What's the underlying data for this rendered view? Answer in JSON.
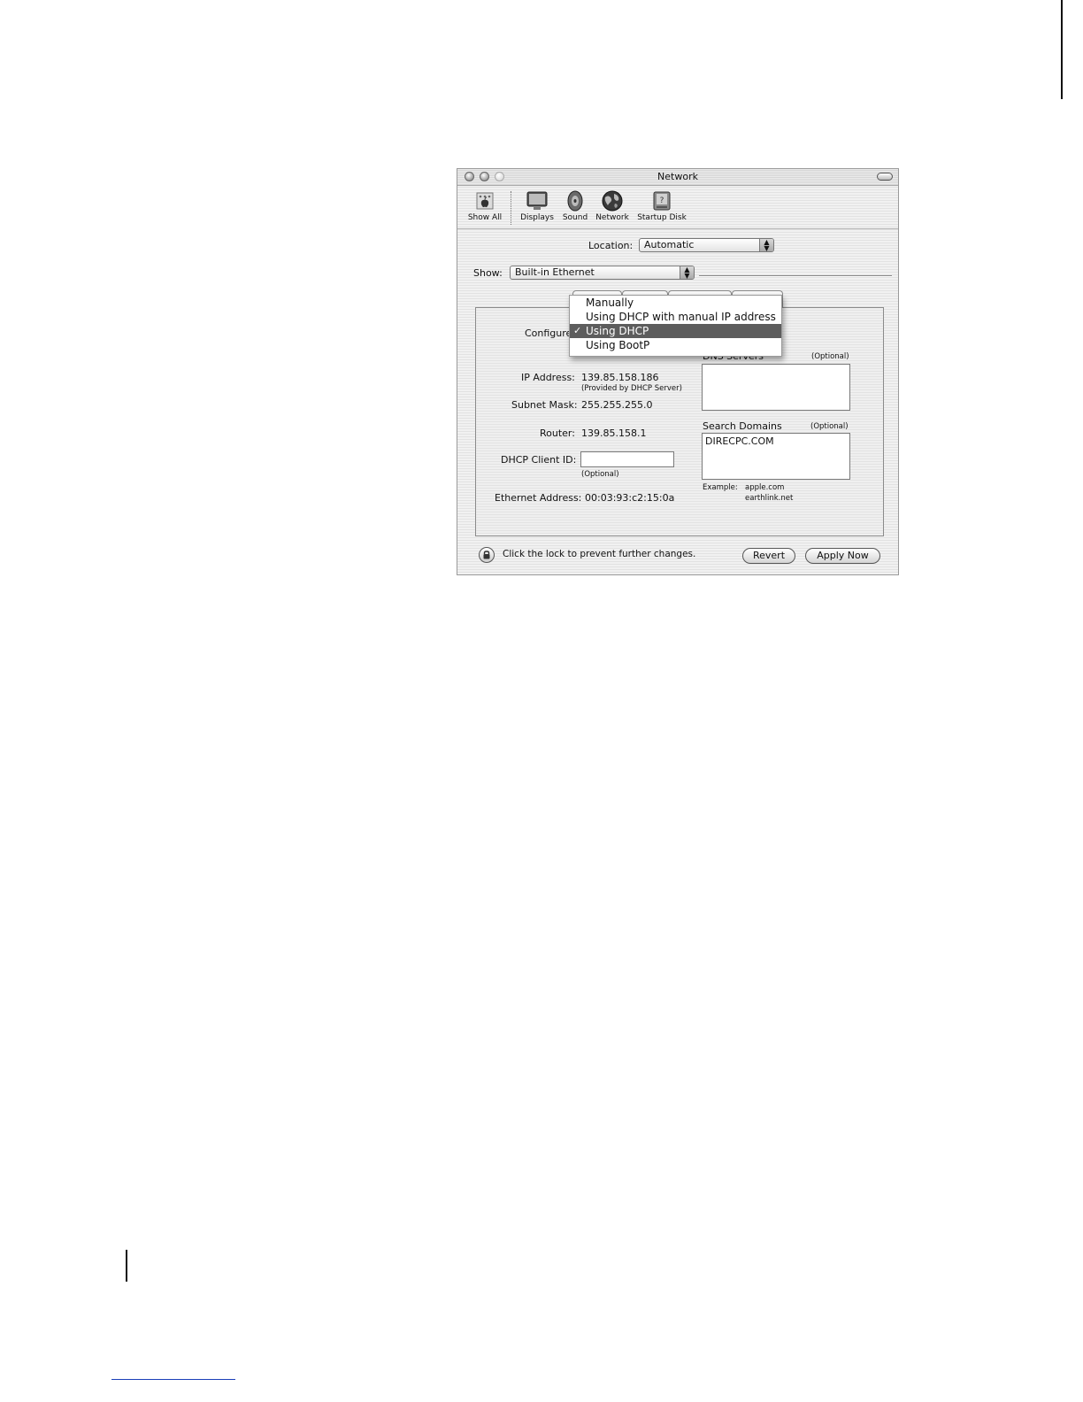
{
  "window": {
    "title": "Network"
  },
  "toolbar": {
    "items": [
      {
        "label": "Show All",
        "icon": "apple-icon"
      },
      {
        "label": "Displays",
        "icon": "display-icon"
      },
      {
        "label": "Sound",
        "icon": "speaker-icon"
      },
      {
        "label": "Network",
        "icon": "globe-icon"
      },
      {
        "label": "Startup Disk",
        "icon": "disk-icon"
      }
    ]
  },
  "location": {
    "label": "Location:",
    "value": "Automatic"
  },
  "show": {
    "label": "Show:",
    "value": "Built-in Ethernet"
  },
  "configure": {
    "label": "Configure",
    "options": [
      {
        "label": "Manually",
        "selected": false
      },
      {
        "label": "Using DHCP with manual IP address",
        "selected": false
      },
      {
        "label": "Using DHCP",
        "selected": true
      },
      {
        "label": "Using BootP",
        "selected": false
      }
    ],
    "check_mark": "✓"
  },
  "tcpip": {
    "ip_label": "IP Address:",
    "ip_value": "139.85.158.186",
    "ip_note": "(Provided by DHCP Server)",
    "subnet_label": "Subnet Mask:",
    "subnet_value": "255.255.255.0",
    "router_label": "Router:",
    "router_value": "139.85.158.1",
    "client_id_label": "DHCP Client ID:",
    "client_id_value": "",
    "client_id_note": "(Optional)",
    "ethernet_label": "Ethernet Address:",
    "ethernet_value": "00:03:93:c2:15:0a"
  },
  "dns": {
    "label": "DNS Servers",
    "optional": "(Optional)",
    "value": ""
  },
  "search_domains": {
    "label": "Search Domains",
    "optional": "(Optional)",
    "value": "DIRECPC.COM",
    "example_label": "Example:",
    "example_1": "apple.com",
    "example_2": "earthlink.net"
  },
  "footer": {
    "lock_text": "Click the lock to prevent further changes.",
    "revert_label": "Revert",
    "apply_label": "Apply Now"
  }
}
